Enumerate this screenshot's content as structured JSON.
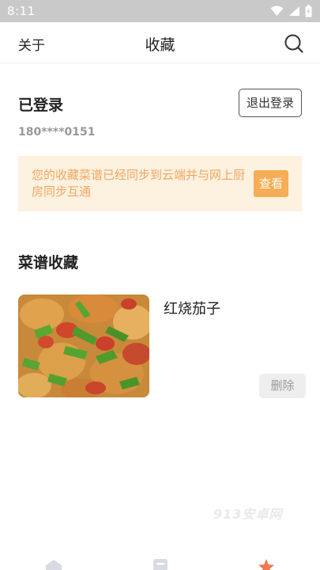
{
  "status_bar": {
    "time": "8:11",
    "icons": [
      "wifi-icon",
      "cellular-signal-icon",
      "battery-icon"
    ]
  },
  "nav": {
    "left_label": "关于",
    "title": "收藏",
    "right_icon": "search-icon"
  },
  "account": {
    "title": "已登录",
    "phone": "180****0151",
    "logout_label": "退出登录"
  },
  "sync_banner": {
    "text": "您的收藏菜谱已经同步到云端并与网上厨房同步互通",
    "button_label": "查看"
  },
  "favorites": {
    "section_title": "菜谱收藏",
    "items": [
      {
        "name": "红烧茄子",
        "delete_label": "删除"
      }
    ]
  },
  "watermark": "913安卓网",
  "tab_bar": {
    "icons": [
      "home-icon",
      "recipe-book-icon",
      "favorite-icon"
    ],
    "active_color": "#f07a50",
    "inactive_color": "#d8dbe2"
  },
  "colors": {
    "accent": "#f5ad56",
    "banner_bg": "#fdf1e0",
    "banner_text": "#f0a860"
  }
}
